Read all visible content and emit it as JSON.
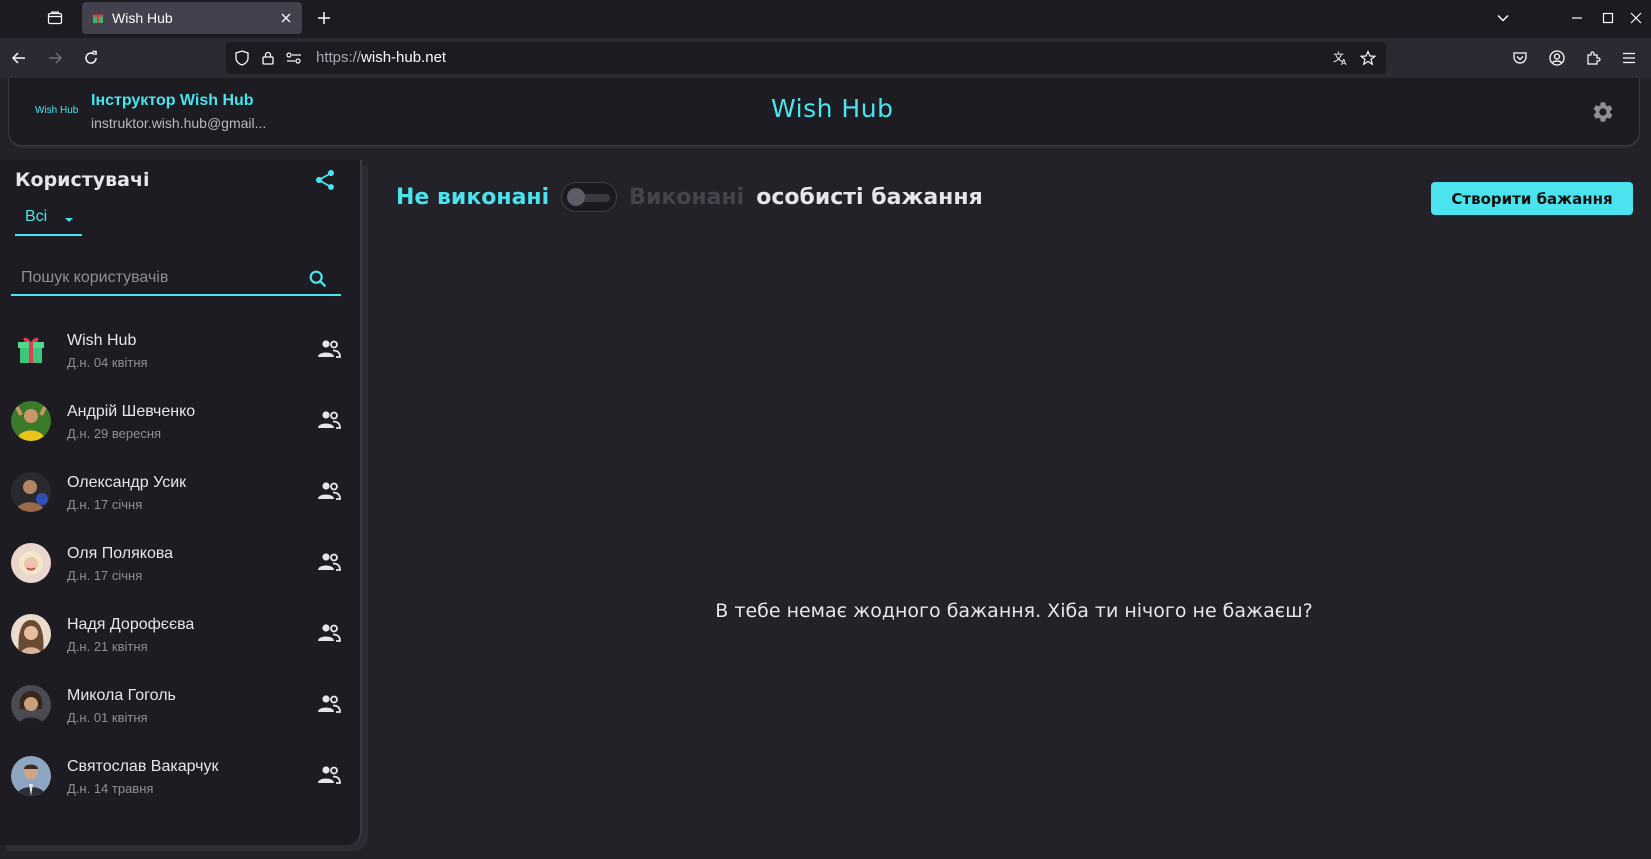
{
  "browser": {
    "tab_title": "Wish Hub",
    "url_prefix": "https://",
    "url_domain": "wish-hub.net"
  },
  "header": {
    "logo_text": "Wish Hub",
    "user_name": "Інструктор Wish Hub",
    "user_email": "instruktor.wish.hub@gmail...",
    "brand": "Wish Hub"
  },
  "sidebar": {
    "title": "Користувачі",
    "filter_value": "Всі",
    "search_placeholder": "Пошук користувачів",
    "users": [
      {
        "name": "Wish Hub",
        "date": "Д.н. 04 квітня"
      },
      {
        "name": "Андрій Шевченко",
        "date": "Д.н. 29 вересня"
      },
      {
        "name": "Олександр Усик",
        "date": "Д.н. 17 січня"
      },
      {
        "name": "Оля Полякова",
        "date": "Д.н. 17 січня"
      },
      {
        "name": "Надя Дорофєєва",
        "date": "Д.н. 21 квітня"
      },
      {
        "name": "Микола Гоголь",
        "date": "Д.н. 01 квітня"
      },
      {
        "name": "Святослав Вакарчук",
        "date": "Д.н. 14 травня"
      }
    ]
  },
  "main": {
    "label_undone": "Не виконані",
    "label_done": "Виконані",
    "label_personal": "особисті бажання",
    "create_button": "Створити бажання",
    "empty_message": "В тебе немає жодного бажання. Хіба ти нічого не бажаєш?"
  },
  "colors": {
    "accent": "#4be3ee",
    "background": "#232229",
    "panel": "#1d1c22"
  }
}
